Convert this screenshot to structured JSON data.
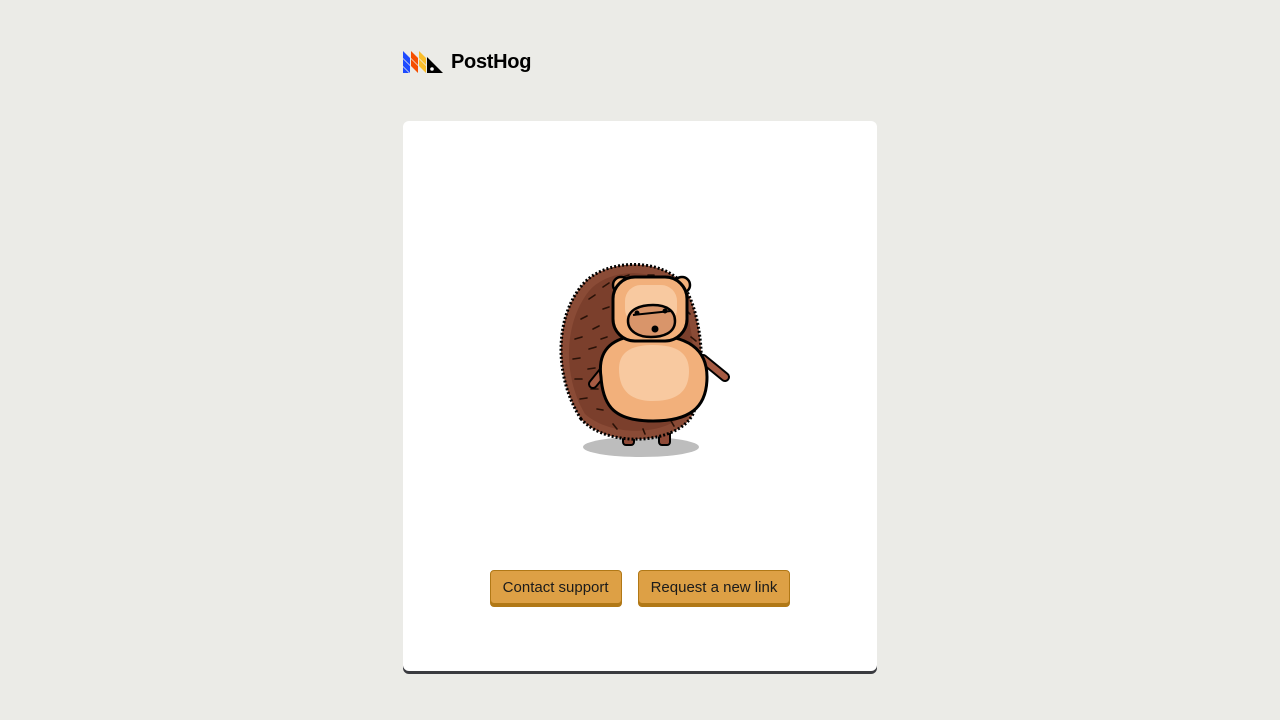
{
  "header": {
    "logo_text": "PostHog",
    "logo_icon": "posthog-logo-icon"
  },
  "main": {
    "illustration": "hedgehog-illustration",
    "buttons": {
      "contact_support": "Contact support",
      "request_new_link": "Request a new link"
    }
  },
  "colors": {
    "background": "#EBEBE7",
    "card": "#FFFFFF",
    "button": "#DDA045",
    "button_border": "#B17816",
    "logo_blue": "#1D4AFF",
    "logo_orange": "#F54E00",
    "logo_yellow": "#F9BD2B"
  }
}
